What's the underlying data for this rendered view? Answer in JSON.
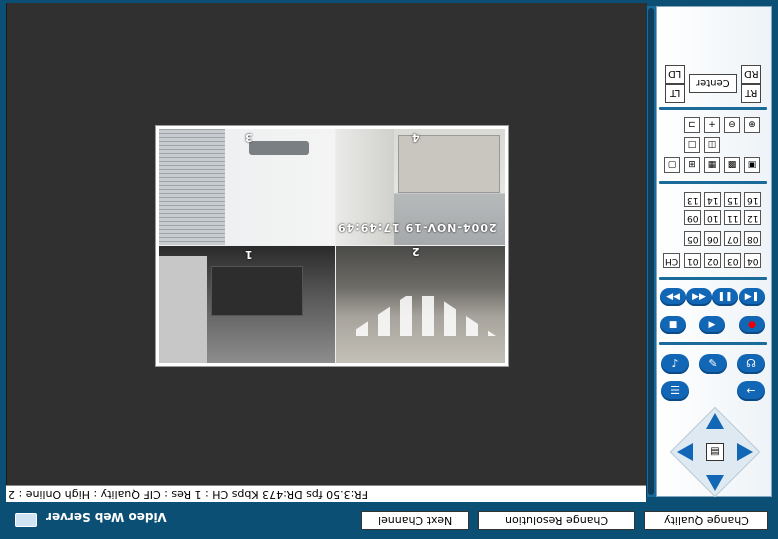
{
  "app": {
    "title": "Video Web Server"
  },
  "video": {
    "cameras": [
      {
        "label": "3"
      },
      {
        "label": "4"
      },
      {
        "label": "1"
      },
      {
        "label": "2"
      }
    ],
    "timestamp": "2004-NOV-19 17:49:49"
  },
  "status_bar": {
    "text": "FR:3.50 fps  DR:473 Kbps  CH : 1   Res : CIF  Quality : High   Online : 2"
  },
  "ptz": {
    "ld": "LD",
    "rd": "RD",
    "center": "Center",
    "lt": "LT",
    "rt": "RT"
  },
  "channels": {
    "ch_label": "CH",
    "row1": [
      "13",
      "14",
      "15",
      "16"
    ],
    "row2": [
      "09",
      "10",
      "11",
      "12"
    ],
    "row3": [
      "05",
      "06",
      "07",
      "08"
    ],
    "row4": [
      "01",
      "02",
      "03",
      "04"
    ]
  },
  "buttons": {
    "next_channel": "Next Channel",
    "change_resolution": "Change Resolution",
    "change_quality": "Change Quality"
  },
  "colors": {
    "accent": "#1166b6",
    "frame": "#0c4f74",
    "video_bg": "#303030"
  }
}
